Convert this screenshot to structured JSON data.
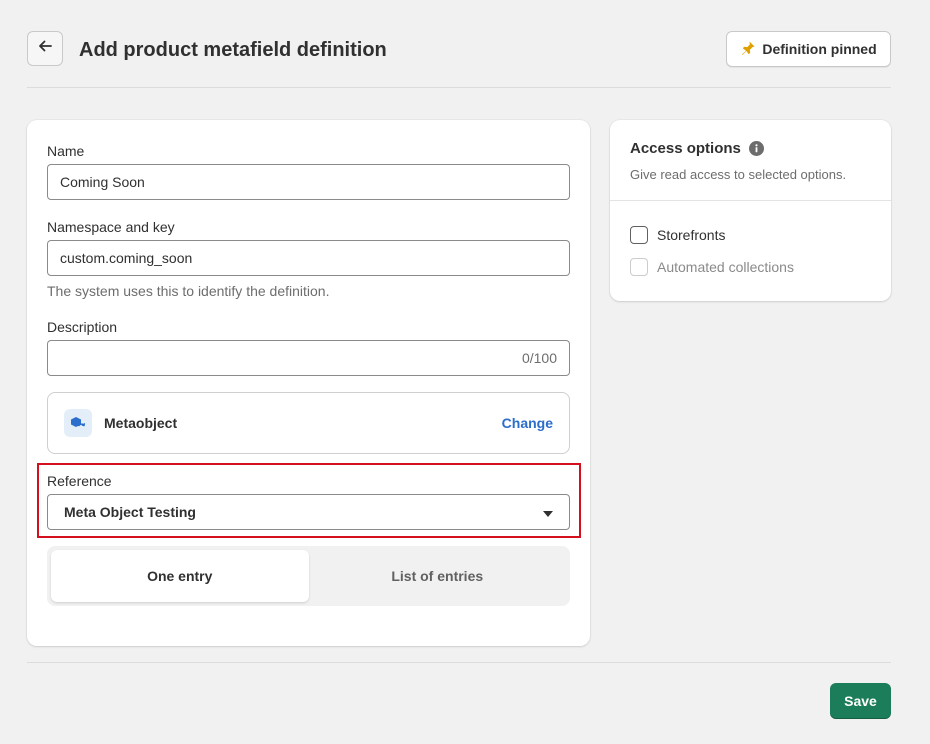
{
  "header": {
    "title": "Add product metafield definition",
    "pinned_label": "Definition pinned",
    "back_icon": "arrow-left-icon",
    "pin_icon": "pin-icon",
    "pin_color": "#e0a100"
  },
  "form": {
    "name": {
      "label": "Name",
      "value": "Coming Soon"
    },
    "namespace": {
      "label": "Namespace and key",
      "value": "custom.coming_soon",
      "help": "The system uses this to identify the definition."
    },
    "description": {
      "label": "Description",
      "value": "",
      "count": "0/100"
    },
    "type": {
      "name": "Metaobject",
      "change_label": "Change",
      "icon": "metaobject-icon"
    },
    "reference": {
      "label": "Reference",
      "selected": "Meta Object Testing"
    },
    "entries": {
      "options": [
        "One entry",
        "List of entries"
      ],
      "selected": "One entry"
    }
  },
  "access": {
    "title": "Access options",
    "subtitle": "Give read access to selected options.",
    "options": [
      {
        "label": "Storefronts",
        "checked": false,
        "disabled": false
      },
      {
        "label": "Automated collections",
        "checked": false,
        "disabled": true
      }
    ]
  },
  "footer": {
    "save_label": "Save",
    "save_color": "#1b7d5a"
  },
  "colors": {
    "link": "#2c6ecb",
    "highlight_border": "#d40f1e"
  }
}
